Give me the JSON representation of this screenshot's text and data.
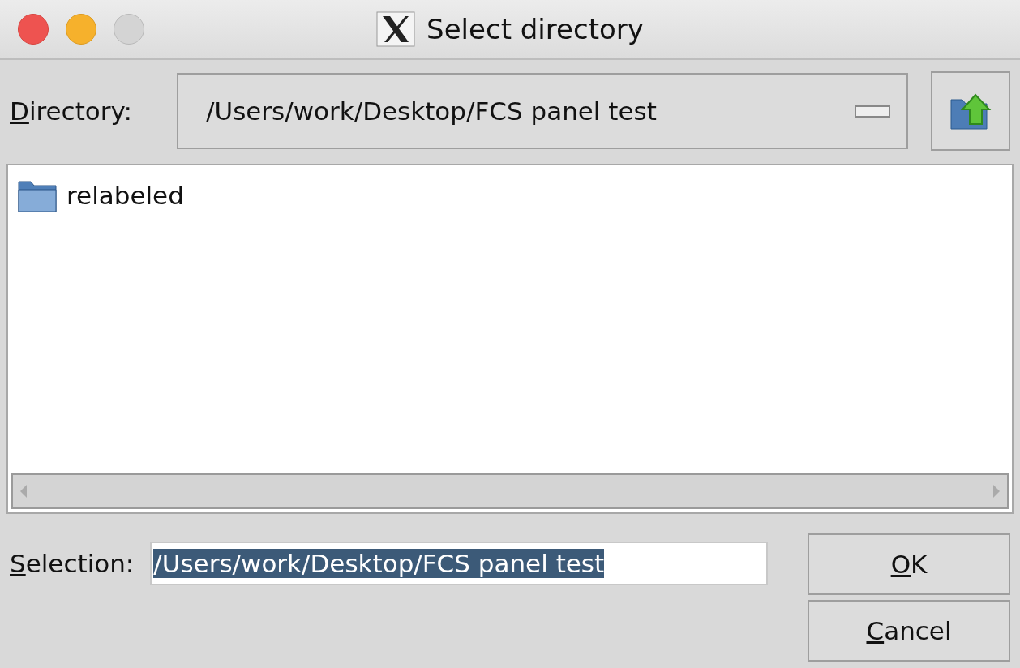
{
  "window": {
    "title": "Select directory"
  },
  "directory": {
    "label": {
      "mnemonic": "D",
      "rest": "irectory:"
    },
    "value": "/Users/work/Desktop/FCS panel test"
  },
  "files": [
    {
      "name": "relabeled",
      "kind": "folder",
      "selected": false
    }
  ],
  "selection": {
    "label": {
      "mnemonic": "S",
      "rest": "election:"
    },
    "value": "/Users/work/Desktop/FCS panel test",
    "text_selected": true
  },
  "buttons": [
    {
      "mnemonic": "O",
      "rest": "K"
    },
    {
      "mnemonic": "C",
      "rest": "ancel"
    }
  ]
}
